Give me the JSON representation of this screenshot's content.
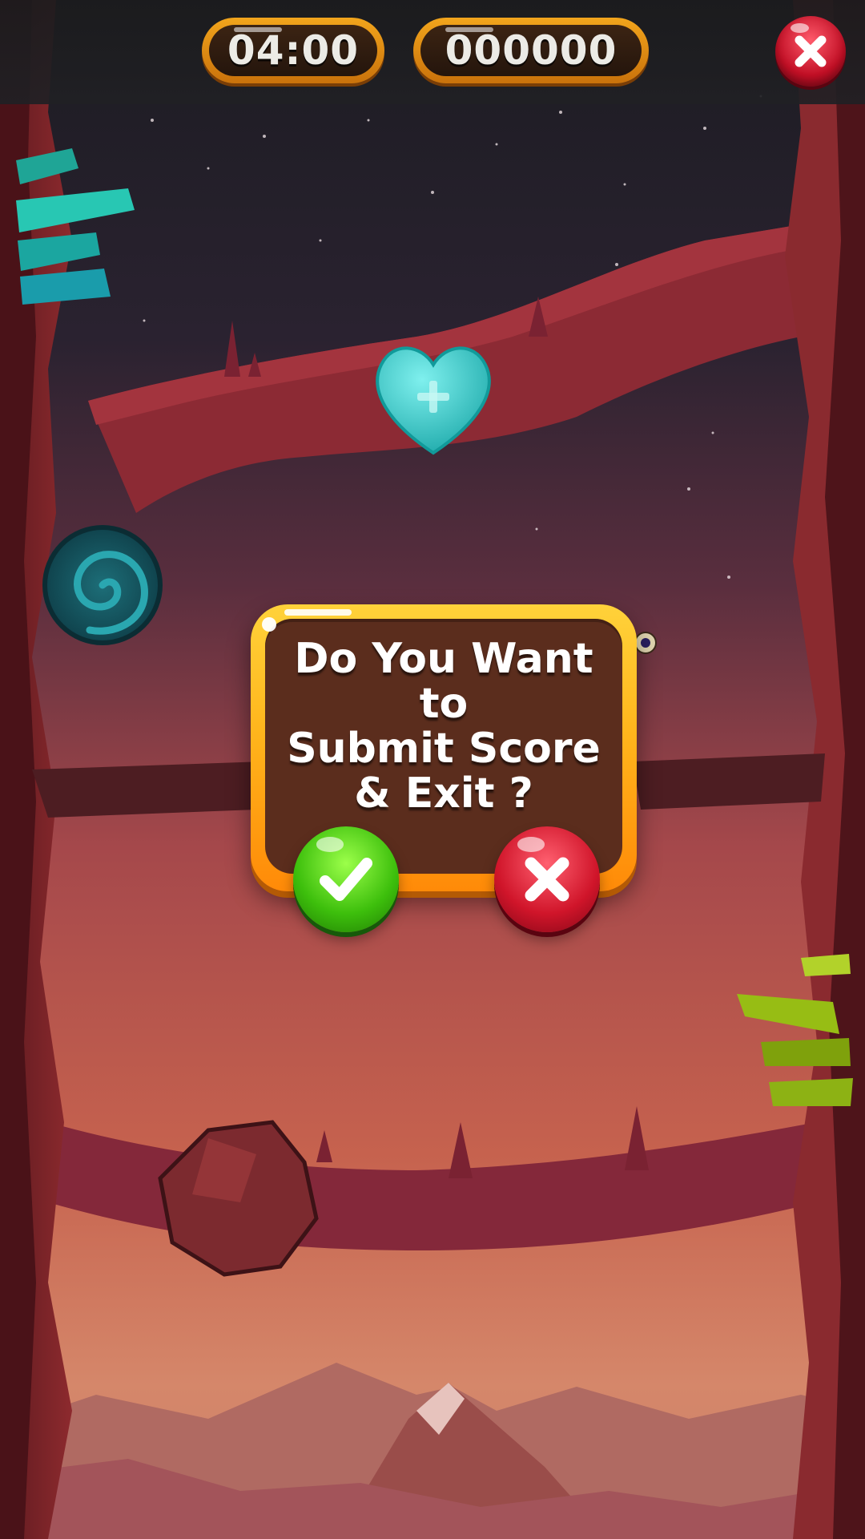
{
  "hud": {
    "timer": "04:00",
    "score": "000000",
    "close_icon": "close-icon"
  },
  "dialog": {
    "message_lines": [
      "Do You Want",
      "to",
      "Submit Score",
      "& Exit ?"
    ],
    "confirm_icon": "checkmark-icon",
    "cancel_icon": "close-icon"
  },
  "colors": {
    "dialog_frame": "#ffb51c",
    "dialog_panel": "#5b2d1d",
    "confirm": "#3dbf0c",
    "cancel": "#d0152a",
    "hud_pill": "#f2a51c"
  }
}
